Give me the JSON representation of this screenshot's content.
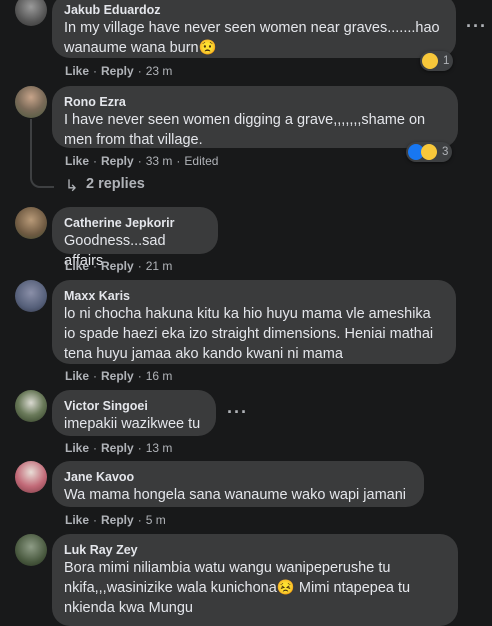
{
  "comments": [
    {
      "author": "Jakub Eduardoz",
      "text": "In my village have never seen women near graves.......hao wanaume wana burn😟",
      "actions": {
        "like": "Like",
        "reply": "Reply",
        "time": "23 m"
      },
      "reaction_count": "1"
    },
    {
      "author": "Rono Ezra",
      "text": "I have never seen women digging a grave,,,,,,,shame on men from that village.",
      "actions": {
        "like": "Like",
        "reply": "Reply",
        "time": "33 m",
        "edited": "Edited"
      },
      "reaction_count": "3",
      "replies": "2 replies"
    },
    {
      "author": "Catherine Jepkorir",
      "text": "Goodness...sad affairs",
      "actions": {
        "like": "Like",
        "reply": "Reply",
        "time": "21 m"
      }
    },
    {
      "author": "Maxx Karis",
      "text": "lo ni chocha hakuna kitu ka hio huyu mama vle ameshika io spade haezi eka izo straight dimensions. Heniai mathai tena huyu jamaa ako kando kwani ni mama",
      "actions": {
        "like": "Like",
        "reply": "Reply",
        "time": "16 m"
      }
    },
    {
      "author": "Victor Singoei",
      "text": "imepakii wazikwee tu",
      "actions": {
        "like": "Like",
        "reply": "Reply",
        "time": "13 m"
      }
    },
    {
      "author": "Jane Kavoo",
      "text": "Wa mama hongela sana wanaume wako wapi jamani",
      "actions": {
        "like": "Like",
        "reply": "Reply",
        "time": "5 m"
      }
    },
    {
      "author": "Luk Ray Zey",
      "text": "Bora mimi niliambia watu wangu wanipeperushe tu nkifa,,,wasinizike wala kunichona😣 Mimi ntapepea tu nkienda kwa Mungu"
    }
  ],
  "more_options": "···"
}
